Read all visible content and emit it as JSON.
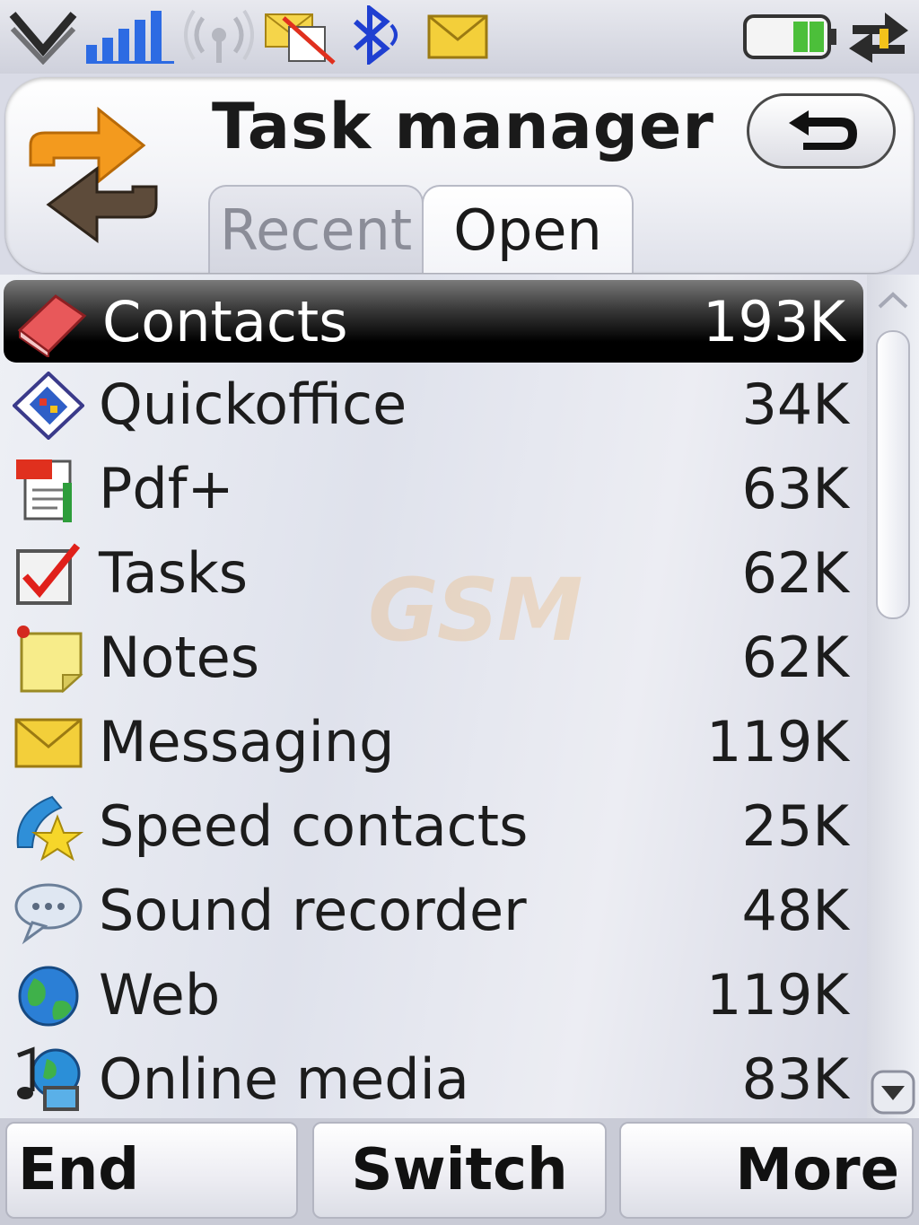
{
  "header": {
    "title": "Task manager",
    "tabs": [
      {
        "label": "Recent",
        "active": false
      },
      {
        "label": "Open",
        "active": true
      }
    ]
  },
  "watermark": "GSM",
  "list": {
    "items": [
      {
        "label": "Contacts",
        "size": "193K",
        "icon": "contacts-book-icon",
        "selected": true
      },
      {
        "label": "Quickoffice",
        "size": "34K",
        "icon": "quickoffice-icon",
        "selected": false
      },
      {
        "label": "Pdf+",
        "size": "63K",
        "icon": "pdf-icon",
        "selected": false
      },
      {
        "label": "Tasks",
        "size": "62K",
        "icon": "tasks-checkbox-icon",
        "selected": false
      },
      {
        "label": "Notes",
        "size": "62K",
        "icon": "notes-sticky-icon",
        "selected": false
      },
      {
        "label": "Messaging",
        "size": "119K",
        "icon": "envelope-icon",
        "selected": false
      },
      {
        "label": "Speed contacts",
        "size": "25K",
        "icon": "speed-contacts-star-icon",
        "selected": false
      },
      {
        "label": "Sound recorder",
        "size": "48K",
        "icon": "speech-bubble-icon",
        "selected": false
      },
      {
        "label": "Web",
        "size": "119K",
        "icon": "globe-icon",
        "selected": false
      },
      {
        "label": "Online media",
        "size": "83K",
        "icon": "online-media-icon",
        "selected": false
      }
    ]
  },
  "softkeys": {
    "left": "End",
    "middle": "Switch",
    "right": "More"
  },
  "colors": {
    "selected_row": "#000000",
    "accent_orange": "#f39a1e",
    "bluetooth": "#1f3fd1"
  }
}
